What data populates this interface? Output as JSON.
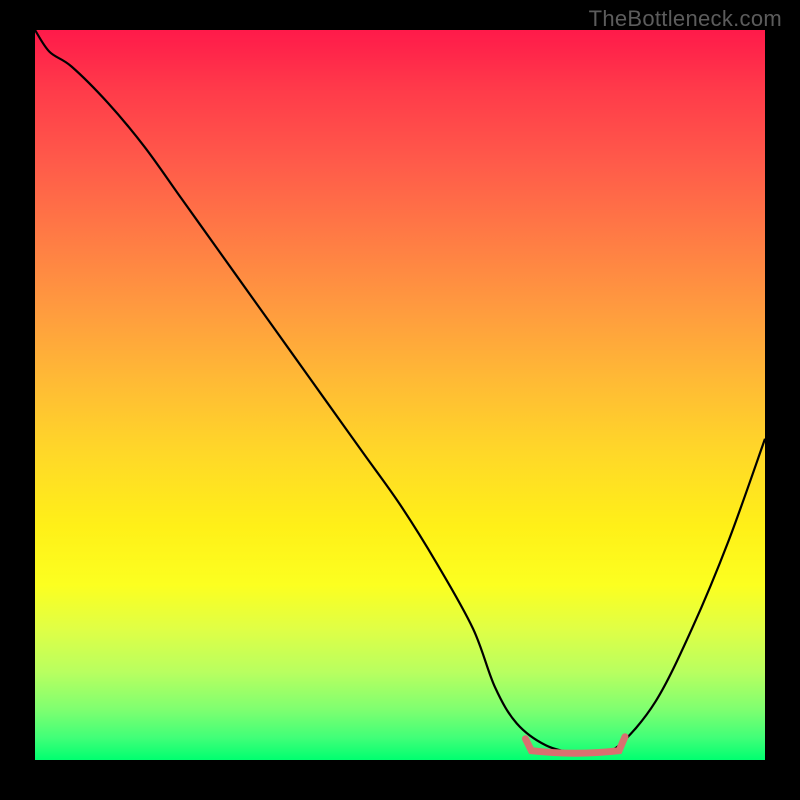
{
  "watermark": "TheBottleneck.com",
  "chart_data": {
    "type": "line",
    "title": "",
    "xlabel": "",
    "ylabel": "",
    "xlim": [
      0,
      100
    ],
    "ylim": [
      0,
      100
    ],
    "x": [
      0,
      2,
      5,
      10,
      15,
      20,
      25,
      30,
      35,
      40,
      45,
      50,
      55,
      60,
      63,
      66,
      70,
      74,
      77,
      80,
      85,
      90,
      95,
      100
    ],
    "values": [
      100,
      97,
      95,
      90,
      84,
      77,
      70,
      63,
      56,
      49,
      42,
      35,
      27,
      18,
      10,
      5,
      2,
      1,
      1,
      2,
      8,
      18,
      30,
      44
    ],
    "highlight_range": {
      "x_start": 68,
      "x_end": 80,
      "y": 1
    },
    "gradient": {
      "top": "#ff1a4a",
      "mid_upper": "#ff9a3f",
      "mid": "#fff018",
      "bottom": "#00ff70"
    }
  }
}
